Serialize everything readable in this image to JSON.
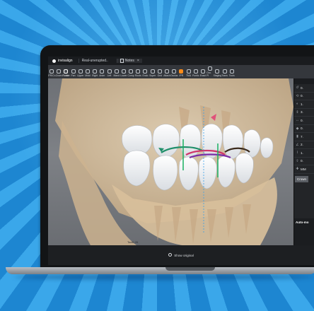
{
  "app": {
    "logo_text": "invisalign",
    "tabs": [
      {
        "label": "Real-unerupted.."
      },
      {
        "label": "Notes"
      }
    ]
  },
  "toolbar": {
    "items": [
      {
        "label": "IPR/Co",
        "icon": "ipr-icon"
      },
      {
        "label": "Zoom",
        "icon": "zoom-icon"
      },
      {
        "label": "Rotate",
        "icon": "rotate-icon"
      },
      {
        "label": "Pan",
        "icon": "pan-icon"
      },
      {
        "label": "Upper",
        "icon": "upper-jaw-icon"
      },
      {
        "label": "Midd",
        "icon": "middle-icon"
      },
      {
        "label": "Right",
        "icon": "right-view-icon"
      },
      {
        "label": "Anter",
        "icon": "anterior-icon"
      },
      {
        "label": "Left",
        "icon": "left-view-icon"
      },
      {
        "label": "Mand",
        "icon": "mandible-icon"
      },
      {
        "label": "Lower",
        "icon": "lower-jaw-icon"
      },
      {
        "label": "Comp",
        "icon": "compare-icon"
      },
      {
        "label": "Roots",
        "icon": "roots-icon"
      },
      {
        "label": "Endo",
        "icon": "endo-icon"
      },
      {
        "label": "Super",
        "icon": "superimpose-icon"
      },
      {
        "label": "Grid",
        "icon": "grid-icon"
      },
      {
        "label": "Attach",
        "icon": "attachment-icon"
      },
      {
        "label": "Occlus",
        "icon": "occlusion-icon"
      },
      {
        "label": "IPR",
        "icon": "ipr-tool-icon"
      },
      {
        "label": "TMA",
        "icon": "tma-icon"
      },
      {
        "label": "Pontic",
        "icon": "pontic-icon"
      },
      {
        "label": "Exact",
        "icon": "exact-icon"
      },
      {
        "label": "Occ. Pl",
        "icon": "occlusal-plane-icon"
      },
      {
        "label": "Staging",
        "icon": "staging-icon"
      },
      {
        "label": "Trans",
        "icon": "transparency-icon"
      },
      {
        "label": "Tools",
        "icon": "tools-icon"
      }
    ]
  },
  "right_panel": {
    "rows": [
      {
        "icon": "rotation-icon",
        "value": "0."
      },
      {
        "icon": "tip-icon",
        "value": "0."
      },
      {
        "icon": "torque-icon",
        "value": "1."
      },
      {
        "icon": "extrusion-icon",
        "value": "3."
      },
      {
        "icon": "translation-icon",
        "value": "0."
      },
      {
        "icon": "mesial-icon",
        "value": "0."
      },
      {
        "icon": "buccal-icon",
        "value": "7."
      },
      {
        "icon": "angle-icon",
        "value": "2."
      },
      {
        "icon": "root-icon",
        "value": "1."
      },
      {
        "icon": "crown-height-icon",
        "value": "0."
      }
    ],
    "mm_label": "MM",
    "crown_label": "Crown",
    "auto_label": "Auto-mo"
  },
  "viewport": {
    "corner_label": "Tooth 26"
  },
  "statusbar": {
    "show_original": "Show original"
  },
  "colors": {
    "accent": "#ff8c1a",
    "background_blue": "#1f86cf",
    "bone": "#d9c1a0"
  }
}
